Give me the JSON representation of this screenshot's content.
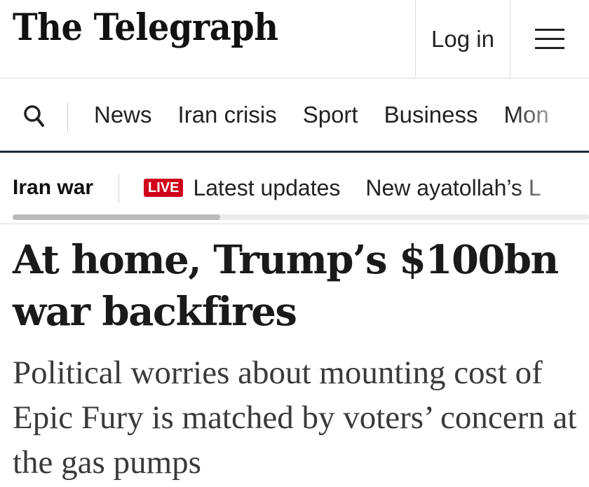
{
  "header": {
    "masthead": "The Telegraph",
    "login_label": "Log in",
    "menu_icon": "hamburger-menu-icon"
  },
  "nav": {
    "search_icon": "search-icon",
    "items": [
      "News",
      "Iran crisis",
      "Sport",
      "Business",
      "Mon"
    ]
  },
  "subnav": {
    "title": "Iran war",
    "live_badge": "LIVE",
    "links": [
      "Latest updates",
      "New ayatollah’s L"
    ],
    "scroll_progress": 0.36
  },
  "article": {
    "headline": "At home, Trump’s $100bn war backfires",
    "standfirst": "Political worries about mounting cost of Epic Fury is matched by voters’ concern at the gas pumps"
  },
  "colors": {
    "live_red": "#d0021b",
    "nav_rule": "#1d2a36"
  }
}
